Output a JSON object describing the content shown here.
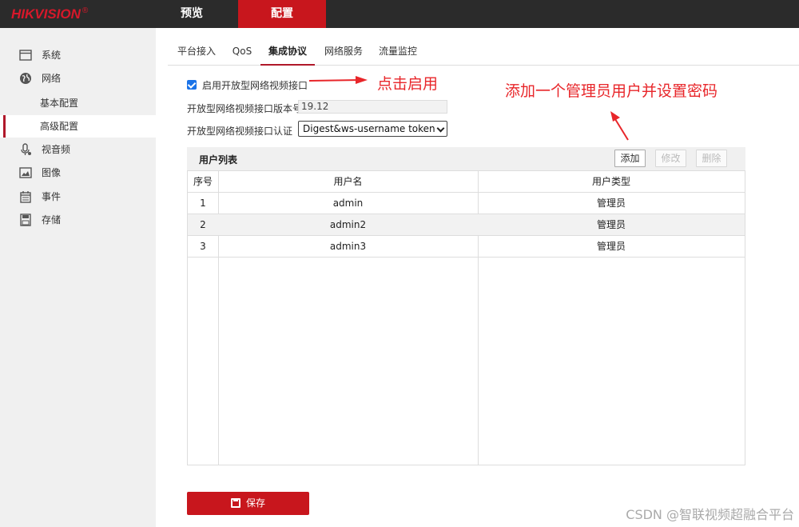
{
  "header": {
    "logo": "HIKVISION",
    "logo_mark": "®",
    "nav": [
      {
        "label": "预览"
      },
      {
        "label": "配置"
      }
    ]
  },
  "sidebar": {
    "items": [
      {
        "label": "系统",
        "icon": "system-window-icon"
      },
      {
        "label": "网络",
        "icon": "globe-icon"
      },
      {
        "label": "基本配置"
      },
      {
        "label": "高级配置"
      },
      {
        "label": "视音频",
        "icon": "microphone-icon"
      },
      {
        "label": "图像",
        "icon": "image-icon"
      },
      {
        "label": "事件",
        "icon": "calendar-icon"
      },
      {
        "label": "存储",
        "icon": "disk-icon"
      }
    ],
    "active": "高级配置"
  },
  "tabs": [
    {
      "label": "平台接入"
    },
    {
      "label": "QoS"
    },
    {
      "label": "集成协议"
    },
    {
      "label": "网络服务"
    },
    {
      "label": "流量监控"
    }
  ],
  "form": {
    "enable_label": "启用开放型网络视频接口",
    "enable_checked": true,
    "version_label": "开放型网络视频接口版本号",
    "version_value": "19.12",
    "auth_label": "开放型网络视频接口认证",
    "auth_value": "Digest&ws-username token"
  },
  "annotations": {
    "click_enable": "点击启用",
    "add_admin": "添加一个管理员用户并设置密码",
    "color": "#e8262a"
  },
  "user_list": {
    "title": "用户列表",
    "buttons": {
      "add": "添加",
      "edit": "修改",
      "delete": "删除"
    },
    "columns": [
      "序号",
      "用户名",
      "用户类型"
    ],
    "rows": [
      [
        "1",
        "admin",
        "管理员"
      ],
      [
        "2",
        "admin2",
        "管理员"
      ],
      [
        "3",
        "admin3",
        "管理员"
      ]
    ]
  },
  "save_label": "保存",
  "watermark": "CSDN @智联视频超融合平台",
  "colors": {
    "brand_red": "#c8161d",
    "topbar": "#2b2b2b"
  }
}
